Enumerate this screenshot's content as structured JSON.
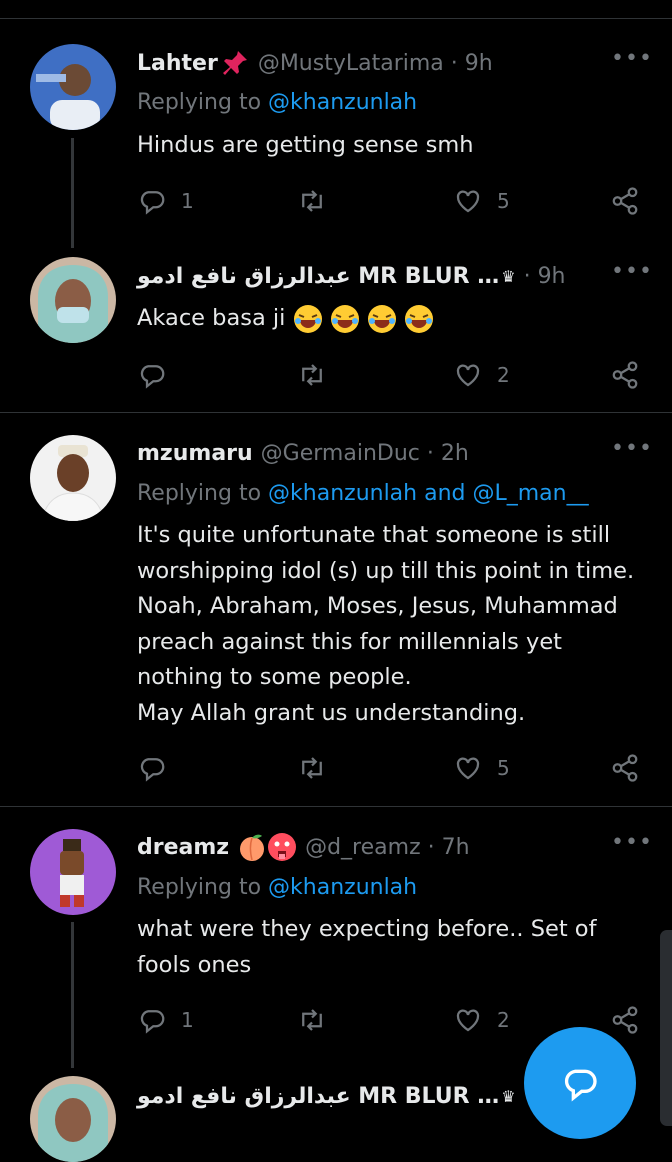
{
  "tweets": [
    {
      "name": "Lahter",
      "name_emoji": "pin",
      "handle": "@MustyLatarima · 9h",
      "replying_label": "Replying to ",
      "replying_to": "@khanzunlah",
      "text": "Hindus are getting sense smh",
      "reply_count": "1",
      "retweet_count": "",
      "like_count": "5"
    },
    {
      "name": "عبدالرزاق نافع ادمو MR BLUR …",
      "handle": "· 9h",
      "text": "Akace basa ji",
      "reply_count": "",
      "retweet_count": "",
      "like_count": "2"
    },
    {
      "name": "mzumaru",
      "handle": "@GermainDuc · 2h",
      "replying_label": "Replying to ",
      "replying_to": "@khanzunlah and @L_man__",
      "text_lines": [
        "It's quite unfortunate that someone is still",
        "worshipping idol (s) up till this point in time.",
        "Noah, Abraham, Moses, Jesus, Muhammad",
        "preach against this for millennials yet",
        "nothing to some people.",
        "May Allah grant us understanding."
      ],
      "reply_count": "",
      "retweet_count": "",
      "like_count": "5"
    },
    {
      "name": "dreamz",
      "handle": "@d_reamz · 7h",
      "replying_label": "Replying to ",
      "replying_to": "@khanzunlah",
      "text_lines": [
        "what were they expecting before.. Set of",
        "fools ones"
      ],
      "reply_count": "1",
      "retweet_count": "",
      "like_count": "2"
    },
    {
      "name": "عبدالرزاق نافع ادمو MR BLUR …"
    }
  ],
  "icons": {
    "reply": "reply-icon",
    "retweet": "retweet-icon",
    "like": "heart-icon",
    "share": "share-icon",
    "more": "more-icon",
    "compose": "compose-reply-icon"
  },
  "colors": {
    "accent": "#1d9bf0",
    "muted": "#71767b",
    "text": "#e7e9ea",
    "divider": "#2f3336"
  }
}
